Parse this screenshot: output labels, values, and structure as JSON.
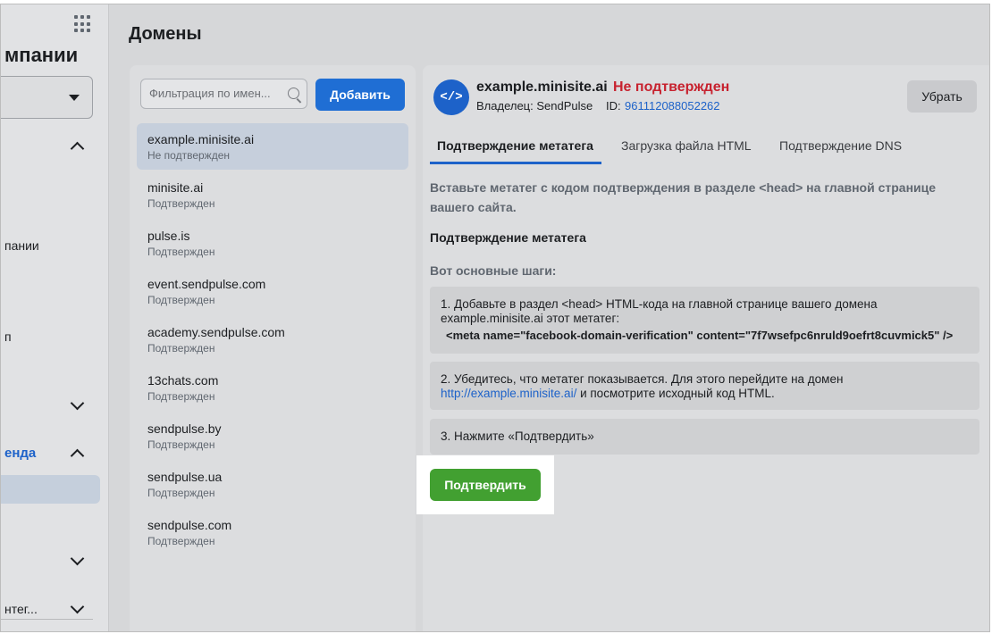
{
  "sidebar": {
    "title": "мпании",
    "item_companies": "пании",
    "item_small": "п",
    "section_blue": "енда",
    "bottom_item": "нтег..."
  },
  "page": {
    "title": "Домены"
  },
  "list": {
    "filter_placeholder": "Фильтрация по имен...",
    "add_label": "Добавить",
    "domains": [
      {
        "name": "example.minisite.ai",
        "status": "Не подтвержден"
      },
      {
        "name": "minisite.ai",
        "status": "Подтвержден"
      },
      {
        "name": "pulse.is",
        "status": "Подтвержден"
      },
      {
        "name": "event.sendpulse.com",
        "status": "Подтвержден"
      },
      {
        "name": "academy.sendpulse.com",
        "status": "Подтвержден"
      },
      {
        "name": "13chats.com",
        "status": "Подтвержден"
      },
      {
        "name": "sendpulse.by",
        "status": "Подтвержден"
      },
      {
        "name": "sendpulse.ua",
        "status": "Подтвержден"
      },
      {
        "name": "sendpulse.com",
        "status": "Подтвержден"
      }
    ]
  },
  "detail": {
    "domain": "example.minisite.ai",
    "status": "Не подтвержден",
    "owner": "Владелец: SendPulse",
    "id_label": "ID:",
    "id_value": "961112088052262",
    "remove_label": "Убрать",
    "tabs": [
      "Подтверждение метатега",
      "Загрузка файла HTML",
      "Подтверждение DNS"
    ],
    "intro": "Вставьте метатег с кодом подтверждения в разделе <head> на главной странице вашего сайта.",
    "section_title": "Подтверждение метатега",
    "steps_title": "Вот основные шаги:",
    "step1_text": "1. Добавьте в раздел <head> HTML-кода на главной странице вашего домена example.minisite.ai этот метатег:",
    "step1_meta": "<meta name=\"facebook-domain-verification\" content=\"7f7wsefpc6nruld9oefrt8cuvmick5\" />",
    "step2_text": "2. Убедитесь, что метатег показывается. Для этого перейдите на домен",
    "step2_link": "http://example.minisite.ai/",
    "step2_tail": " и посмотрите исходный код HTML.",
    "step3_text": "3. Нажмите «Подтвердить»",
    "confirm_label": "Подтвердить"
  }
}
